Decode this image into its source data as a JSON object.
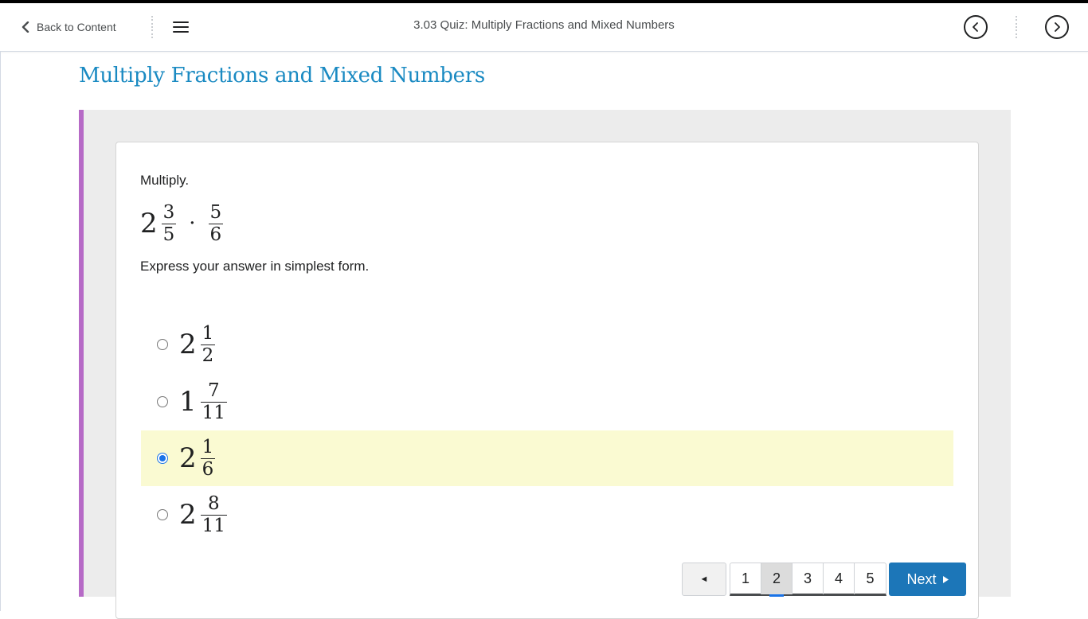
{
  "nav": {
    "back_label": "Back to Content",
    "title": "3.03 Quiz: Multiply Fractions and Mixed Numbers",
    "prev_icon": "circle-chevron-left-icon",
    "next_icon": "circle-chevron-right-icon"
  },
  "page_title": "Multiply Fractions and Mixed Numbers",
  "question": {
    "instruction": "Multiply.",
    "expression": {
      "whole": "2",
      "frac1_num": "3",
      "frac1_den": "5",
      "operator": "·",
      "frac2_num": "5",
      "frac2_den": "6"
    },
    "hint": "Express your answer in simplest form."
  },
  "options": [
    {
      "whole": "2",
      "num": "1",
      "den": "2",
      "selected": false
    },
    {
      "whole": "1",
      "num": "7",
      "den": "11",
      "selected": false
    },
    {
      "whole": "2",
      "num": "1",
      "den": "6",
      "selected": true
    },
    {
      "whole": "2",
      "num": "8",
      "den": "11",
      "selected": false
    }
  ],
  "pager": {
    "prev_glyph": "◄",
    "pages": [
      "1",
      "2",
      "3",
      "4",
      "5"
    ],
    "current": "2",
    "next_label": "Next"
  },
  "colors": {
    "title": "#1a8ac2",
    "accent_bar": "#b66ac6",
    "selected_bg": "#fafad2",
    "next_button": "#1c76b8"
  }
}
